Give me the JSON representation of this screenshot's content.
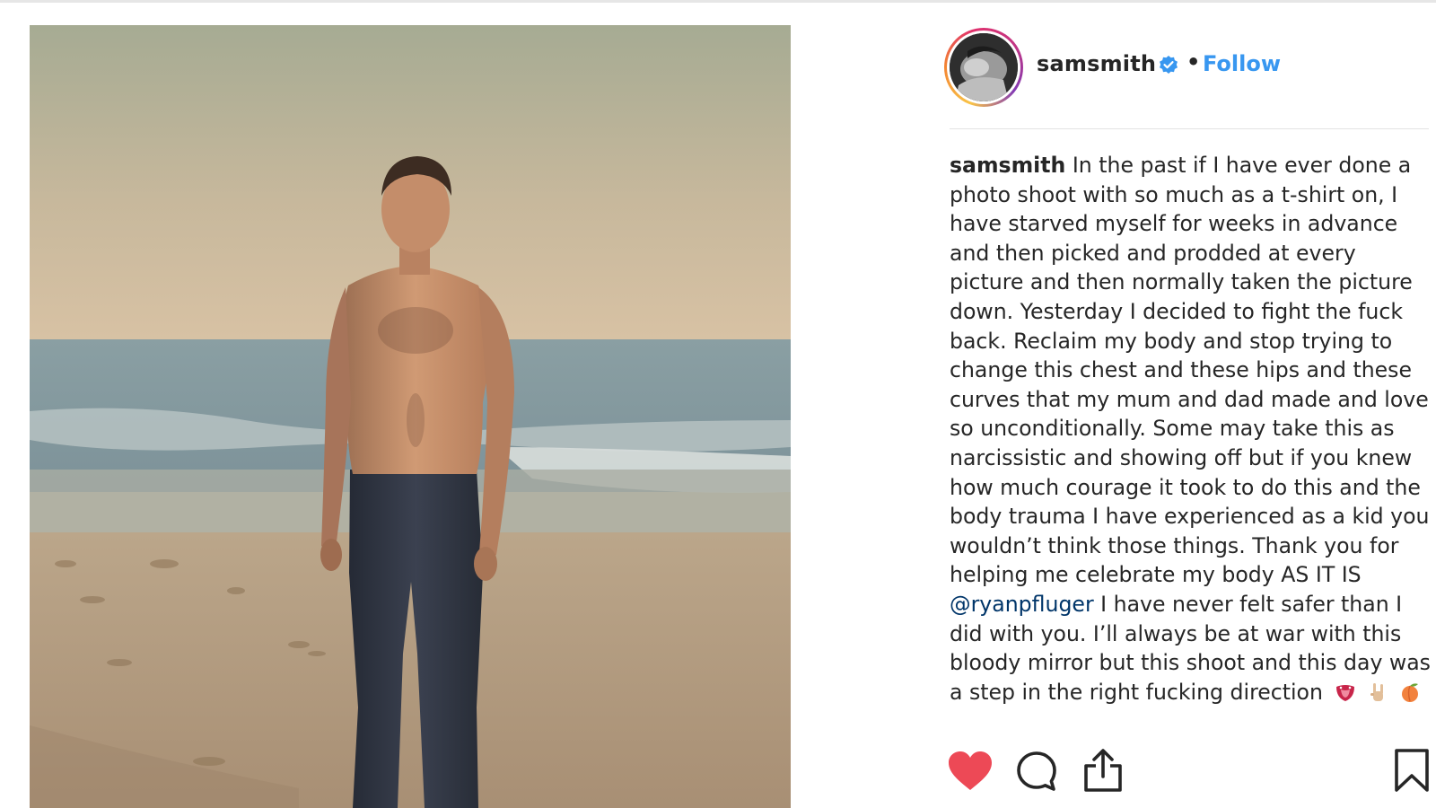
{
  "post": {
    "username": "samsmith",
    "separator": "•",
    "follow_label": "Follow",
    "verified": true,
    "photo_description": "beach-portrait-photo",
    "avatar_description": "profile-avatar"
  },
  "caption": {
    "author": "samsmith",
    "text_part1": "In the past if I have ever done a photo shoot with so much as a t-shirt on, I have starved myself for weeks in advance and then picked and prodded at every picture and then normally taken the picture down. Yesterday I decided to fight the fuck back. Reclaim my body and stop trying to change this chest and these hips and these curves that my mum and dad made and love so unconditionally. Some may take this as narcissistic and showing off but if you knew how much courage it took to do this and the body trauma I have experienced as a kid you wouldn’t think those things. Thank you for helping me celebrate my body AS IT IS ",
    "mention": "@ryanpfluger",
    "text_part2": " I have never felt safer than I did with you. I’ll always be at war with this bloody mirror but this shoot and this day was a step in the right fucking direction",
    "emojis": [
      "tongue-emoji",
      "rock-hand-emoji",
      "peach-emoji"
    ]
  },
  "actions": {
    "like_icon": "heart-icon",
    "comment_icon": "comment-icon",
    "share_icon": "share-icon",
    "save_icon": "bookmark-icon",
    "liked": true
  },
  "colors": {
    "follow": "#3897f0",
    "verified": "#3897f0",
    "like": "#ed4956",
    "mention": "#003569",
    "text": "#262626"
  }
}
